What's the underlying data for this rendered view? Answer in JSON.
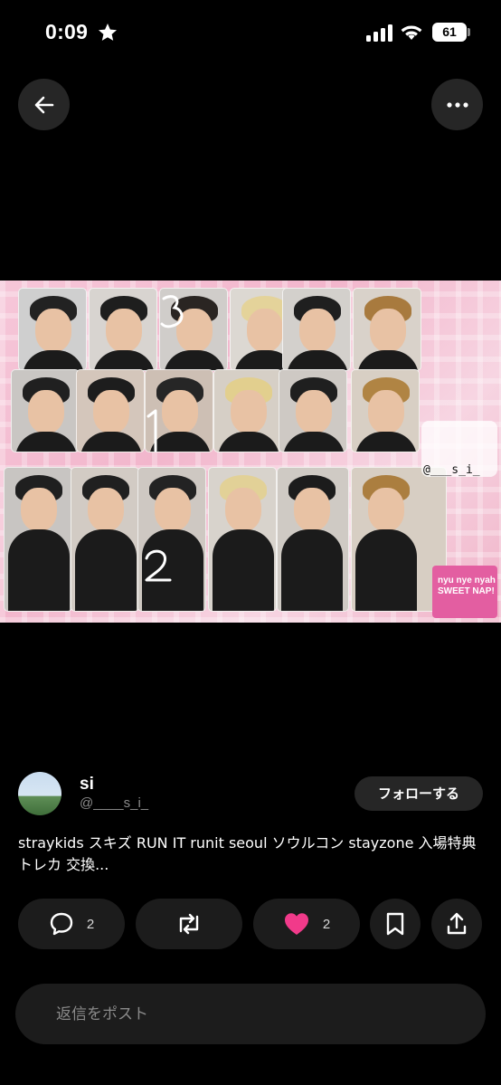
{
  "status_bar": {
    "time": "0:09",
    "battery": "61",
    "icons": [
      "star-icon",
      "signal-icon",
      "wifi-icon",
      "battery-icon"
    ]
  },
  "nav": {
    "back_icon": "arrow-left-icon",
    "more_icon": "more-horizontal-icon"
  },
  "photo": {
    "watermark": "@___s_i_",
    "sticker_text": "nyu nye nyah SWEET NAP!"
  },
  "author": {
    "name": "si",
    "handle": "@____s_i_",
    "follow_label": "フォローする"
  },
  "post": {
    "text": "straykids スキズ RUN IT runit seoul ソウルコン stayzone 入場特典 トレカ 交換..."
  },
  "actions": {
    "reply_count": "2",
    "like_count": "2",
    "like_color": "#f13a8a"
  },
  "reply_box": {
    "placeholder": "返信をポスト"
  }
}
